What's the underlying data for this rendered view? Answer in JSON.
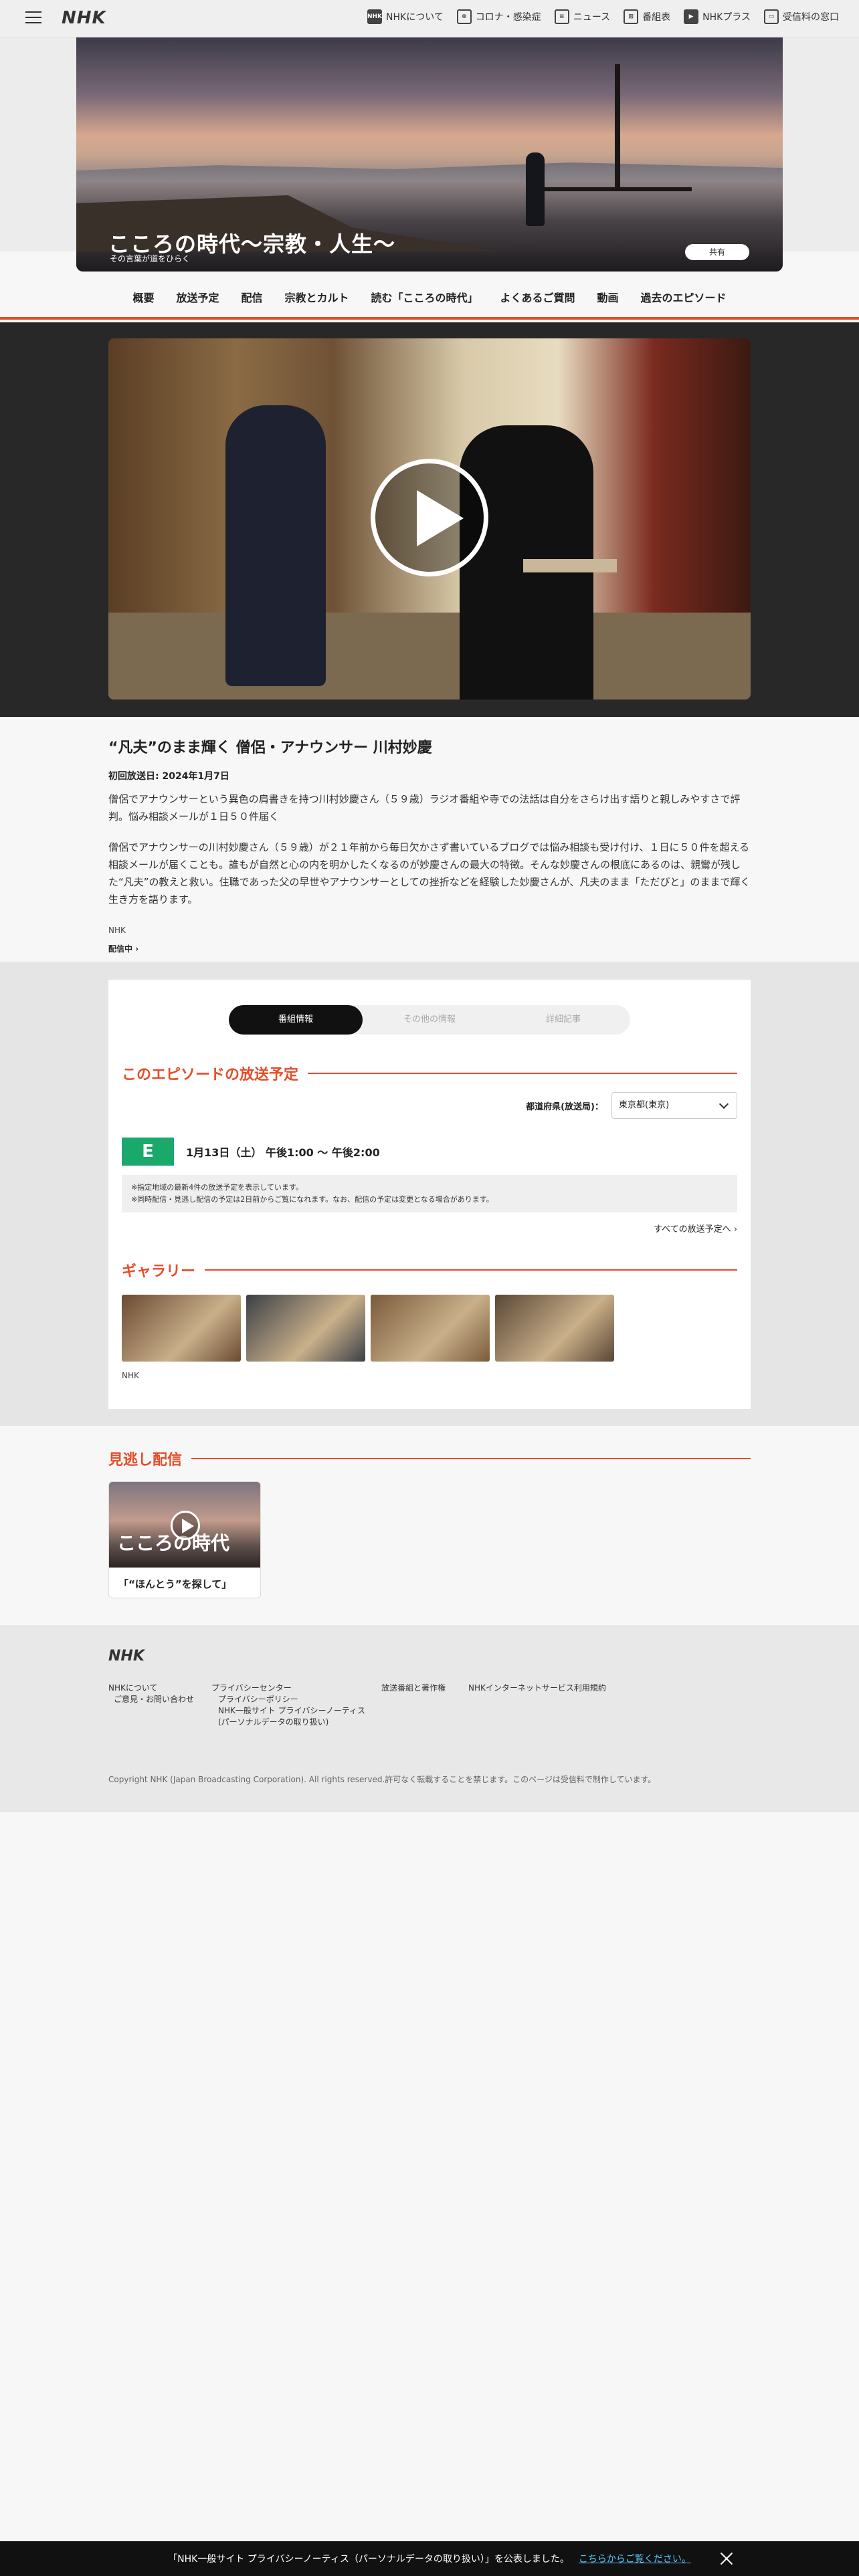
{
  "header": {
    "logo": "NHK",
    "nav": [
      {
        "label": "NHKについて",
        "icon": "nhk-icon",
        "glyph": "NHK"
      },
      {
        "label": "コロナ・感染症",
        "icon": "virus-icon",
        "glyph": "⊕"
      },
      {
        "label": "ニュース",
        "icon": "news-icon",
        "glyph": "≡"
      },
      {
        "label": "番組表",
        "icon": "grid-icon",
        "glyph": "⊞"
      },
      {
        "label": "NHKプラス",
        "icon": "nhkplus-icon",
        "glyph": "▶"
      },
      {
        "label": "受信料の窓口",
        "icon": "tv-icon",
        "glyph": "▭"
      }
    ]
  },
  "hero": {
    "title": "こころの時代〜宗教・人生〜",
    "subtitle": "その言葉が道をひらく",
    "share": "共有"
  },
  "program_nav": [
    "概要",
    "放送予定",
    "配信",
    "宗教とカルト",
    "読む「こころの時代」",
    "よくあるご質問",
    "動画",
    "過去のエピソード"
  ],
  "episode": {
    "title": "“凡夫”のまま輝く 僧侶・アナウンサー 川村妙慶",
    "first_air": "初回放送日: 2024年1月7日",
    "lead": "僧侶でアナウンサーという異色の肩書きを持つ川村妙慶さん（５９歳）ラジオ番組や寺での法話は自分をさらけ出す語りと親しみやすさで評判。悩み相談メールが１日５０件届く",
    "body": "僧侶でアナウンサーの川村妙慶さん（５９歳）が２１年前から毎日欠かさず書いているブログでは悩み相談も受け付け、１日に５０件を超える相談メールが届くことも。誰もが自然と心の内を明かしたくなるのが妙慶さんの最大の特徴。そんな妙慶さんの根底にあるのは、親鸞が残した“凡夫”の教えと救い。住職であった父の早世やアナウンサーとしての挫折などを経験した妙慶さんが、凡夫のまま「ただびと」のままで輝く生き方を語ります。",
    "credit": "NHK",
    "stream_link": "配信中"
  },
  "info_tabs": [
    "番組情報",
    "その他の情報",
    "詳細記事"
  ],
  "broadcast": {
    "heading": "このエピソードの放送予定",
    "pref_label": "都道府県(放送局)：",
    "pref_value": "東京都(東京)",
    "channel": "E",
    "time": "1月13日（土） 午後1:00 〜 午後2:00",
    "notice1": "※指定地域の最新4件の放送予定を表示しています。",
    "notice2": "※同時配信・見逃し配信の予定は2日前からご覧になれます。なお、配信の予定は変更となる場合があります。",
    "all_link": "すべての放送予定へ"
  },
  "gallery": {
    "heading": "ギャラリー",
    "credit": "NHK",
    "thumbs": [
      "#6b4a32",
      "#3b3f46",
      "#7a5a3a",
      "#5a4634"
    ]
  },
  "miss": {
    "heading": "見逃し配信",
    "thumb_title": "こころの時代",
    "label": "「“ほんとう”を探して」"
  },
  "footer": {
    "logo": "NHK",
    "col1": [
      "NHKについて",
      "ご意見・お問い合わせ"
    ],
    "col2": [
      "プライバシーセンター",
      "プライバシーポリシー",
      "NHK一般サイト プライバシーノーティス",
      "(パーソナルデータの取り扱い)"
    ],
    "col3": [
      "放送番組と著作権"
    ],
    "col4": [
      "NHKインターネットサービス利用規約"
    ],
    "copyright": "Copyright NHK (Japan Broadcasting Corporation). All rights reserved.許可なく転載することを禁じます。このページは受信料で制作しています。"
  },
  "privacy_bar": {
    "text": "「NHK一般サイト プライバシーノーティス（パーソナルデータの取り扱い）」を公表しました。",
    "link": "こちらからご覧ください。"
  },
  "colors": {
    "accent": "#e64d2a",
    "etv": "#1aa96b",
    "dark": "#282828"
  }
}
